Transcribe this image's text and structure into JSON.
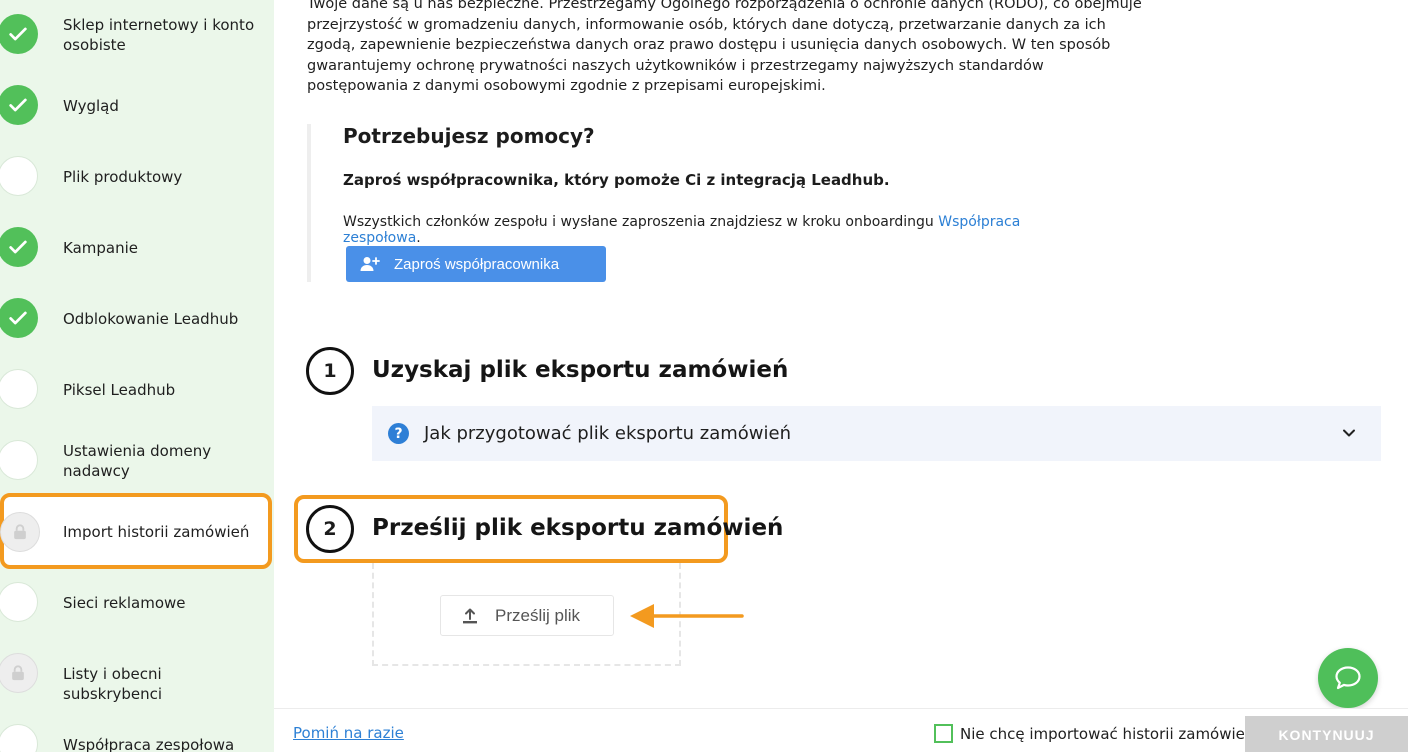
{
  "sidebar": {
    "steps": [
      {
        "label": "Sklep internetowy i konto osobiste",
        "state": "done"
      },
      {
        "label": "Wygląd",
        "state": "done"
      },
      {
        "label": "Plik produktowy",
        "state": "todo"
      },
      {
        "label": "Kampanie",
        "state": "done"
      },
      {
        "label": "Odblokowanie Leadhub",
        "state": "done"
      },
      {
        "label": "Piksel Leadhub",
        "state": "todo"
      },
      {
        "label": "Ustawienia domeny nadawcy",
        "state": "todo"
      },
      {
        "label": "Import historii zamówień",
        "state": "locked"
      },
      {
        "label": "Sieci reklamowe",
        "state": "todo"
      },
      {
        "label": "Listy i obecni subskrybenci",
        "state": "locked"
      },
      {
        "label": "Współpraca zespołowa",
        "state": "todo"
      }
    ],
    "active_step": "Import historii zamówień"
  },
  "intro": {
    "text": "Twoje dane są u nas bezpieczne. Przestrzegamy Ogólnego rozporządzenia o ochronie danych (RODO), co obejmuje przejrzystość w gromadzeniu danych, informowanie osób, których dane dotyczą, przetwarzanie danych za ich zgodą, zapewnienie bezpieczeństwa danych oraz prawo dostępu i usunięcia danych osobowych. W ten sposób gwarantujemy ochronę prywatności naszych użytkowników i przestrzegamy najwyższych standardów postępowania z danymi osobowymi zgodnie z przepisami europejskimi."
  },
  "help": {
    "title": "Potrzebujesz pomocy?",
    "subtitle": "Zaproś współpracownika, który pomoże Ci z integracją Leadhub.",
    "text": "Wszystkich członków zespołu i wysłane zaproszenia znajdziesz w kroku onboardingu ",
    "link": "Współpraca zespołowa",
    "text_end": ".",
    "button": "Zaproś współpracownika"
  },
  "section1": {
    "number": "1",
    "title": "Uzyskaj plik eksportu zamówień",
    "accordion": "Jak przygotować plik eksportu zamówień"
  },
  "section2": {
    "number": "2",
    "title": "Prześlij plik eksportu zamówień",
    "upload_button": "Prześlij plik"
  },
  "footer": {
    "skip": "Pomiń na razie",
    "optout": "Nie chcę importować historii zamówień",
    "continue": "KONTYNUUJ"
  },
  "colors": {
    "accent_green": "#52c05a",
    "highlight_orange": "#f39a1f",
    "primary_blue": "#4a90e8",
    "link_blue": "#2d80d5"
  }
}
